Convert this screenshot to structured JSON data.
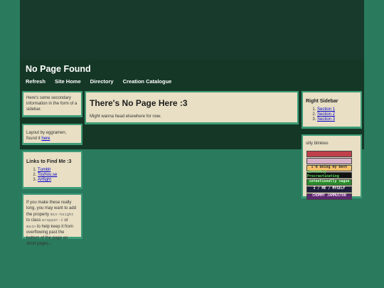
{
  "header": {
    "title": "No Page Found",
    "nav": [
      "Refresh",
      "Site Home",
      "Directory",
      "Creation Catalogue"
    ]
  },
  "left": {
    "box1": "Here's some secondary information in the form of a sidebar.",
    "box2_text": "Layout by eggramen, found it ",
    "box2_link": "here",
    "links_title": "Links to Find Me :3",
    "links": [
      "Tumblr",
      "Toyhou.se",
      "Artfight"
    ],
    "tip_1": "If you make these really long, you may want to add the property ",
    "tip_code1": "min-height",
    "tip_2": " to class ",
    "tip_code2": "wrapper-2",
    "tip_3": " or ",
    "tip_code3": "main",
    "tip_4": " to help keep it from overflowing past the bottom of the page on short pages..."
  },
  "main": {
    "heading": "There's No Page Here :3",
    "body": "Might wanna head elsewhere for now."
  },
  "right": {
    "title": "Right Sidebar",
    "sections": [
      "Section 1",
      "Section 2",
      "Section 3"
    ],
    "blinkies_title": "silly blinkies",
    "blinkies": [
      {
        "text": "",
        "bg": "#c0404a",
        "fg": "#ffffff"
      },
      {
        "text": "",
        "bg": "#d9b0c8",
        "fg": "#3a3a3a"
      },
      {
        "text": "I'm doing my best",
        "bg": "#f4c26a",
        "fg": "#2a2a2a"
      },
      {
        "text": "Currently Procrastinating",
        "bg": "#111111",
        "fg": "#5fe05f"
      },
      {
        "text": "intentionally vague",
        "bg": "#2b8a2b",
        "fg": "#d8ffd8"
      },
      {
        "text": "I / ME / MYSELF",
        "bg": "#1d1d3a",
        "fg": "#ffffff"
      },
      {
        "text": "CHOMMY JAMMUSTON",
        "bg": "#5b2a6e",
        "fg": "#ffe0ff"
      }
    ]
  }
}
